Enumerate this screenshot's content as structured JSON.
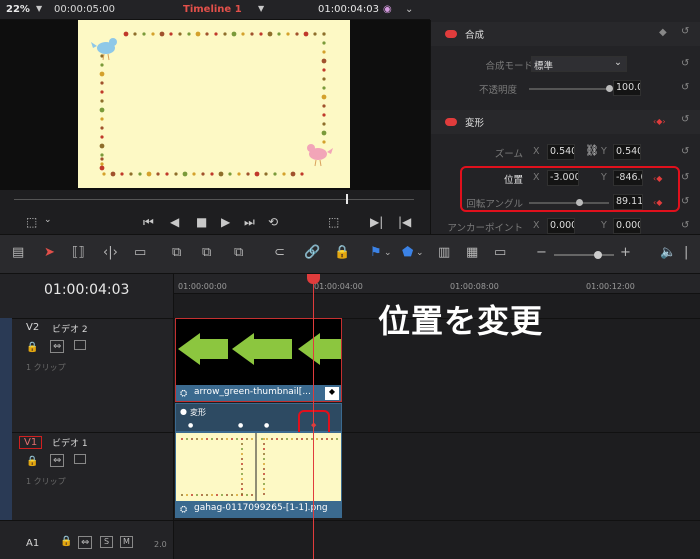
{
  "viewer": {
    "zoom": "22%",
    "source_timecode": "00:00:05:00",
    "timeline_name": "Timeline 1",
    "timecode": "01:00:04:03"
  },
  "inspector": {
    "composite": {
      "header": "合成",
      "mode_label": "合成モード",
      "mode_value": "標準",
      "opacity_label": "不透明度",
      "opacity_value": "100.00"
    },
    "transform": {
      "header": "変形",
      "zoom_label": "ズーム",
      "zoom_x": "0.540",
      "zoom_y": "0.540",
      "position_label": "位置",
      "position_x": "-3.000",
      "position_y": "-846.0",
      "rotation_label": "回転アングル",
      "rotation_value": "89.110",
      "anchor_label": "アンカーポイント",
      "anchor_x": "0.000",
      "anchor_y": "0.000",
      "axis_x": "X",
      "axis_y": "Y"
    }
  },
  "timeline": {
    "timecode": "01:00:04:03",
    "ruler": [
      "01:00:00:00",
      "01:00:04:00",
      "01:00:08:00",
      "01:00:12:00"
    ],
    "tracks": {
      "v2": {
        "id": "V2",
        "name": "ビデオ 2",
        "count": "1 クリップ"
      },
      "v1": {
        "id": "V1",
        "name": "ビデオ 1",
        "count": "1 クリップ"
      },
      "a1": {
        "id": "A1",
        "level": "2.0",
        "solo": "S",
        "mute": "M"
      }
    },
    "clips": {
      "v2_name": "arrow_green-thumbnail[...",
      "v1_name": "gahag-0117099265-[1-1].png",
      "keyframe_lane": "変形"
    }
  },
  "annotation": "位置を変更",
  "colors": {
    "accent_red": "#e0101c",
    "clip_blue": "#3b6a8f",
    "arrow_green": "#8cc63f"
  }
}
